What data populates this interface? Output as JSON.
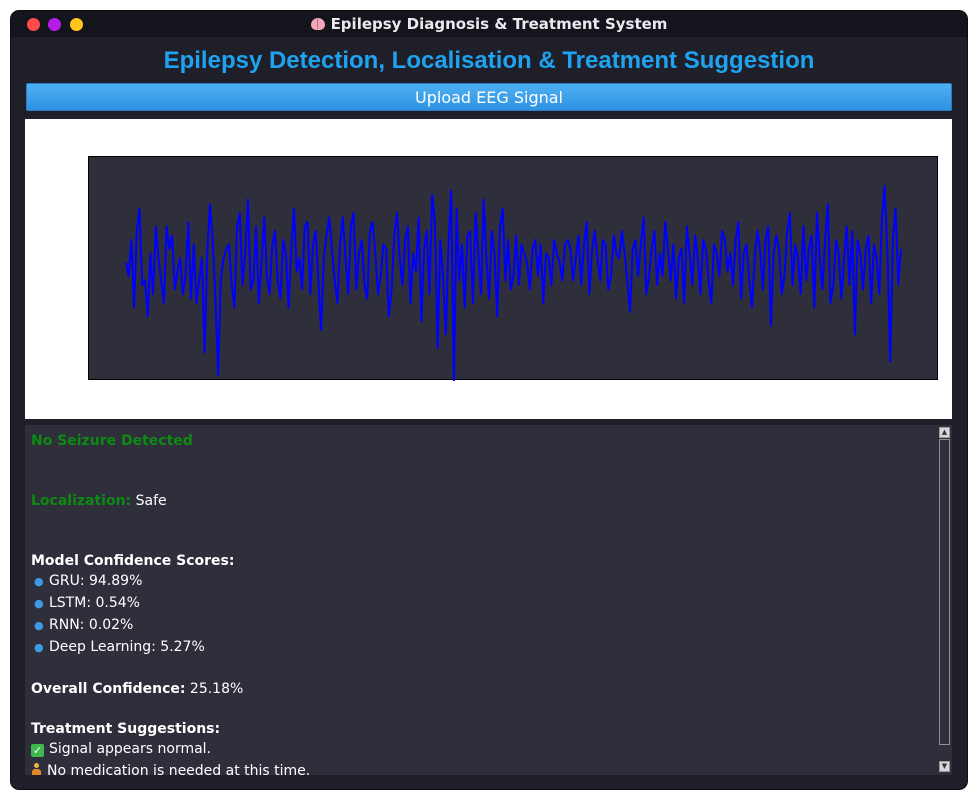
{
  "window": {
    "title": "Epilepsy Diagnosis & Treatment System",
    "title_icon": "brain-icon"
  },
  "header": {
    "heading": "Epilepsy Detection, Localisation & Treatment Suggestion"
  },
  "toolbar": {
    "upload_label": "Upload EEG Signal"
  },
  "colors": {
    "heading": "#1fa3f0",
    "button": "#3a9de8",
    "signal": "#0000ff",
    "status_ok": "#0d8a14"
  },
  "chart_data": {
    "type": "line",
    "title": "",
    "xlabel": "",
    "ylabel": "",
    "series": [
      {
        "values": [
          0.1,
          -0.2,
          0.6,
          -0.9,
          0.8,
          1.3,
          -0.4,
          -0.3,
          -1.1,
          0.3,
          -0.6,
          0.9,
          0.2,
          -0.3,
          -0.8,
          0.9,
          0.4,
          0.7,
          -0.5,
          -0.1,
          0.2,
          -0.6,
          -0.2,
          1.0,
          -0.7,
          0.5,
          -0.8,
          -0.3,
          0.2,
          -1.9,
          0.3,
          1.4,
          0.6,
          -0.7,
          -2.4,
          -0.3,
          0.2,
          0.4,
          0.5,
          -0.4,
          -0.9,
          0.9,
          1.2,
          -0.4,
          0.3,
          1.5,
          -0.5,
          -0.3,
          0.9,
          -0.8,
          0.1,
          1.1,
          -0.2,
          -0.6,
          0.5,
          0.8,
          -0.3,
          -0.7,
          0.6,
          0.3,
          -0.9,
          0.4,
          1.3,
          -0.1,
          0.2,
          -0.5,
          0.9,
          1.0,
          -0.6,
          0.5,
          0.8,
          -0.3,
          -1.4,
          0.2,
          0.7,
          1.1,
          0.4,
          -0.3,
          -0.8,
          0.5,
          1.1,
          0.2,
          -0.6,
          0.9,
          1.2,
          -0.5,
          0.3,
          0.6,
          -0.4,
          -0.7,
          0.8,
          1.0,
          0.3,
          -0.6,
          -0.2,
          0.5,
          0.4,
          -1.1,
          -0.5,
          0.7,
          1.2,
          0.2,
          -0.4,
          0.6,
          0.9,
          -0.8,
          0.3,
          -0.1,
          1.1,
          -1.2,
          0.4,
          0.8,
          -0.6,
          1.6,
          1.0,
          -1.8,
          0.6,
          -0.2,
          -1.5,
          0.5,
          1.7,
          -2.6,
          1.3,
          -0.3,
          0.5,
          -0.9,
          0.7,
          0.8,
          -0.8,
          1.2,
          0.3,
          -0.6,
          1.5,
          0.2,
          -0.7,
          0.8,
          0.3,
          -1.1,
          0.9,
          1.3,
          -0.3,
          0.6,
          -0.5,
          -0.2,
          0.7,
          -0.4,
          0.5,
          0.3,
          0.1,
          -0.5,
          0.4,
          0.6,
          -0.2,
          0.5,
          -0.8,
          0.3,
          0.2,
          -0.4,
          0.6,
          0.3,
          0.1,
          -0.3,
          0.5,
          0.6,
          0.4,
          -0.3,
          0.2,
          0.7,
          -0.4,
          0.5,
          1.0,
          -0.6,
          0.4,
          0.8,
          0.2,
          -0.3,
          0.6,
          0.5,
          -0.5,
          -0.2,
          0.7,
          0.3,
          0.2,
          0.8,
          0.3,
          -0.3,
          -1.0,
          0.4,
          0.6,
          -0.2,
          0.5,
          1.1,
          -0.6,
          -0.2,
          0.4,
          0.8,
          -0.4,
          0.3,
          -0.2,
          1.0,
          0.4,
          -0.3,
          0.5,
          -0.7,
          0.2,
          0.4,
          -0.8,
          0.9,
          0.3,
          -0.4,
          0.7,
          0.2,
          -0.6,
          0.6,
          0.4,
          -0.3,
          -0.8,
          0.5,
          0.3,
          -0.2,
          0.8,
          0.6,
          -0.1,
          0.3,
          -0.4,
          0.6,
          1.0,
          -0.7,
          0.3,
          0.5,
          -0.3,
          -0.9,
          0.2,
          0.8,
          0.4,
          -0.5,
          0.6,
          0.9,
          -1.3,
          0.3,
          0.7,
          0.4,
          -0.6,
          -0.2,
          0.8,
          1.2,
          -0.4,
          0.5,
          0.2,
          -0.6,
          0.9,
          -0.3,
          0.4,
          0.7,
          -0.9,
          1.2,
          0.2,
          -0.5,
          0.6,
          1.4,
          -0.8,
          -0.4,
          0.6,
          0.3,
          -0.7,
          0.2,
          0.9,
          -0.4,
          0.8,
          -1.5,
          0.6,
          0.3,
          -0.5,
          0.4,
          0.7,
          -0.8,
          0.5,
          0.2,
          -0.6,
          1.1,
          1.8,
          0.3,
          -2.1,
          0.6,
          1.3,
          -0.4,
          0.4
        ]
      }
    ]
  },
  "results": {
    "status": "No Seizure Detected",
    "localization_label": "Localization:",
    "localization_value": "Safe",
    "confidence_heading": "Model Confidence Scores:",
    "models": [
      {
        "text": "GRU: 94.89%"
      },
      {
        "text": "LSTM: 0.54%"
      },
      {
        "text": "RNN: 0.02%"
      },
      {
        "text": "Deep Learning: 5.27%"
      }
    ],
    "overall_label": "Overall Confidence:",
    "overall_value": "25.18%",
    "treatment_heading": "Treatment Suggestions:",
    "treatments": [
      {
        "icon": "check-icon",
        "text": "Signal appears normal."
      },
      {
        "icon": "person-icon",
        "text": "No medication is needed at this time."
      }
    ]
  }
}
